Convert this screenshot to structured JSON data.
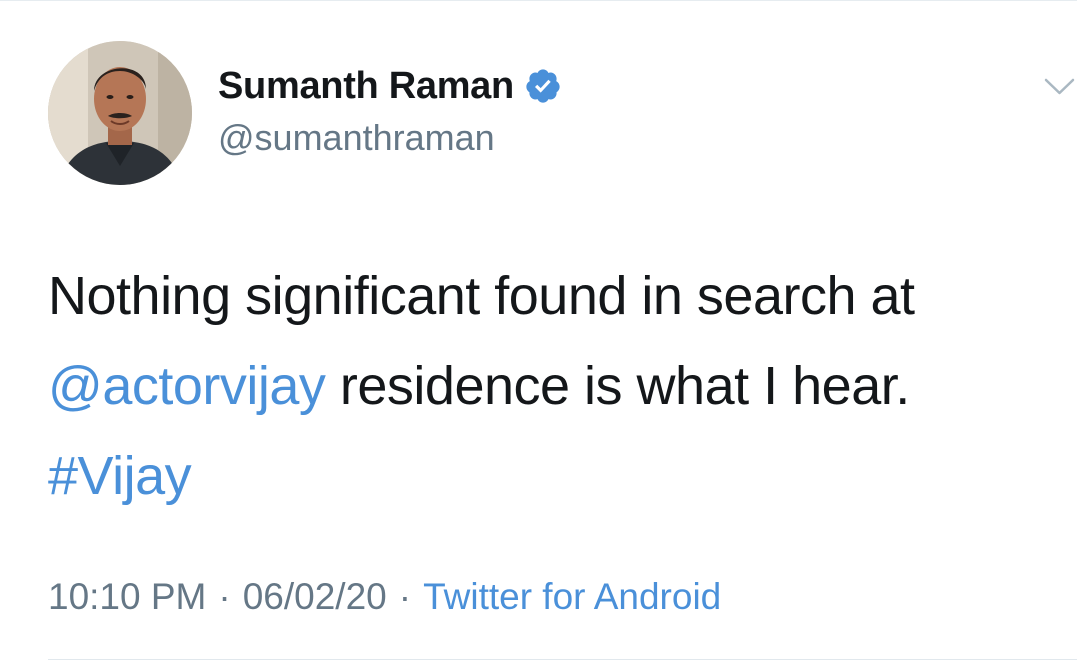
{
  "author": {
    "name": "Sumanth Raman",
    "handle": "@sumanthraman",
    "verified": true
  },
  "tweet": {
    "line1": "Nothing significant found in search at",
    "mention": "@actorvijay",
    "line2_rest": " residence is what I hear.",
    "hashtag": "#Vijay"
  },
  "meta": {
    "time": "10:10 PM",
    "separator": "·",
    "date": "06/02/20",
    "source": "Twitter for Android"
  },
  "colors": {
    "link": "#4a90d9",
    "verified_badge": "#4a90d9",
    "muted_text": "#657786",
    "text": "#14171a"
  },
  "icons": {
    "verified": "verified-badge-icon",
    "menu": "chevron-down-icon"
  }
}
